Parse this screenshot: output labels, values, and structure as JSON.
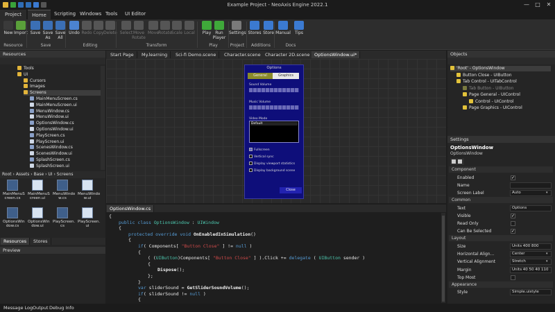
{
  "window_title": "Example Project - NeoAxis Engine 2022.1",
  "menu": {
    "project": "Project",
    "items": [
      "Home",
      "Scripting",
      "Windows",
      "Tools",
      "UI Editor"
    ]
  },
  "ribbon": {
    "buttons": [
      {
        "label": "New",
        "icon": "new-icon",
        "color": "#3a3a3a",
        "enabled": true
      },
      {
        "label": "Import",
        "icon": "import-icon",
        "color": "#5aa03a",
        "enabled": true
      },
      {
        "label": "Save",
        "icon": "save-icon",
        "color": "#3b6fb5",
        "enabled": true
      },
      {
        "label": "Save As",
        "icon": "save-as-icon",
        "color": "#3b6fb5",
        "enabled": true
      },
      {
        "label": "Save All",
        "icon": "save-all-icon",
        "color": "#3b6fb5",
        "enabled": true
      },
      {
        "label": "Undo",
        "icon": "undo-icon",
        "color": "#4b83d1",
        "enabled": true
      },
      {
        "label": "Redo",
        "icon": "redo-icon",
        "color": "#555",
        "enabled": false
      },
      {
        "label": "Copy",
        "icon": "copy-icon",
        "color": "#555",
        "enabled": false
      },
      {
        "label": "Delete",
        "icon": "delete-icon",
        "color": "#555",
        "enabled": false
      },
      {
        "label": "Select",
        "icon": "select-icon",
        "color": "#555",
        "enabled": false
      },
      {
        "label": "Move Rotate",
        "icon": "move-rotate-icon",
        "color": "#555",
        "enabled": false
      },
      {
        "label": "Move",
        "icon": "move-icon",
        "color": "#555",
        "enabled": false
      },
      {
        "label": "Rotate",
        "icon": "rotate-icon",
        "color": "#555",
        "enabled": false
      },
      {
        "label": "Scale",
        "icon": "scale-icon",
        "color": "#555",
        "enabled": false
      },
      {
        "label": "Local",
        "icon": "local-icon",
        "color": "#555",
        "enabled": false
      },
      {
        "label": "Play",
        "icon": "play-icon",
        "color": "#3fa83a",
        "enabled": true
      },
      {
        "label": "Run Player",
        "icon": "run-player-icon",
        "color": "#3fa83a",
        "enabled": true
      },
      {
        "label": "Settings",
        "icon": "settings-icon",
        "color": "#7a7a7a",
        "enabled": true
      },
      {
        "label": "Stores",
        "icon": "stores-icon",
        "color": "#3b7ad1",
        "enabled": true
      },
      {
        "label": "Store",
        "icon": "store-icon",
        "color": "#3b7ad1",
        "enabled": true
      },
      {
        "label": "Manual",
        "icon": "manual-icon",
        "color": "#3b7ad1",
        "enabled": true
      },
      {
        "label": "Tips",
        "icon": "tips-icon",
        "color": "#3b7ad1",
        "enabled": true
      }
    ],
    "groups": [
      "Resource",
      "Save",
      "Editing",
      "Transform",
      "Play",
      "Project",
      "Additions",
      "Docs"
    ]
  },
  "resources": {
    "title": "Resources",
    "tree": [
      {
        "label": "Tools",
        "indent": 1
      },
      {
        "label": "UI",
        "indent": 1
      },
      {
        "label": "Cursors",
        "indent": 2
      },
      {
        "label": "Images",
        "indent": 2
      },
      {
        "label": "Screens",
        "indent": 2
      },
      {
        "label": "MainMenuScreen.cs",
        "indent": 3
      },
      {
        "label": "MainMenuScreen.ui",
        "indent": 3
      },
      {
        "label": "MenuWindow.cs",
        "indent": 3
      },
      {
        "label": "MenuWindow.ui",
        "indent": 3
      },
      {
        "label": "OptionsWindow.cs",
        "indent": 3
      },
      {
        "label": "OptionsWindow.ui",
        "indent": 3
      },
      {
        "label": "PlayScreen.cs",
        "indent": 3
      },
      {
        "label": "PlayScreen.ui",
        "indent": 3
      },
      {
        "label": "ScenesWindow.cs",
        "indent": 3
      },
      {
        "label": "ScenesWindow.ui",
        "indent": 3
      },
      {
        "label": "SplashScreen.cs",
        "indent": 3
      },
      {
        "label": "SplashScreen.ui",
        "indent": 3
      }
    ],
    "breadcrumb": [
      "Root",
      "Assets",
      "Base",
      "UI",
      "Screens"
    ],
    "grid": [
      {
        "label": "MainMenuS creen.cs",
        "kind": "cs"
      },
      {
        "label": "MainMenuS creen.ui",
        "kind": "ui"
      },
      {
        "label": "MenuWindo w.cs",
        "kind": "cs"
      },
      {
        "label": "MenuWindo w.ui",
        "kind": "ui"
      },
      {
        "label": "OptionsWin dow.cs",
        "kind": "cs"
      },
      {
        "label": "OptionsWin dow.ui",
        "kind": "ui"
      },
      {
        "label": "PlayScreen. cs",
        "kind": "cs"
      },
      {
        "label": "PlayScreen. ui",
        "kind": "ui"
      }
    ],
    "bottom_tabs": [
      "Resources",
      "Stores"
    ],
    "preview": "Preview"
  },
  "doc_tabs": [
    "Start Page",
    "My.learning",
    "Sci-fi Demo.scene",
    "Character.scene",
    "Character 2D.scene",
    "OptionsWindow.ui*"
  ],
  "options_window": {
    "title": "Options",
    "tabs": [
      "General",
      "Graphics"
    ],
    "sound_volume": "Sound Volume",
    "music_volume": "Music Volume",
    "video_mode": "Video Mode",
    "video_mode_value": "Default",
    "checks": [
      {
        "label": "Fullscreen",
        "checked": true
      },
      {
        "label": "Vertical sync",
        "checked": false
      },
      {
        "label": "Display viewport statistics",
        "checked": false
      },
      {
        "label": "Display background scene",
        "checked": false
      }
    ],
    "close": "Close"
  },
  "code": {
    "tab": "OptionsWindow.cs",
    "lines": [
      {
        "t": [
          [
            "{",
            "p"
          ]
        ],
        "ind": 0
      },
      {
        "t": [
          [
            "public ",
            "kw"
          ],
          [
            "class ",
            "kw"
          ],
          [
            "OptionsWindow",
            "ty"
          ],
          [
            " : ",
            "p"
          ],
          [
            "UIWindow",
            "ty"
          ]
        ],
        "ind": 1
      },
      {
        "t": [
          [
            "{",
            "p"
          ]
        ],
        "ind": 1
      },
      {
        "t": [
          [
            "protected ",
            "kw"
          ],
          [
            "override ",
            "kw"
          ],
          [
            "void ",
            "kw"
          ],
          [
            "OnEnabledInSimulation",
            "fn"
          ],
          [
            "()",
            "p"
          ]
        ],
        "ind": 2
      },
      {
        "t": [
          [
            "{",
            "p"
          ]
        ],
        "ind": 2
      },
      {
        "t": [
          [
            "if",
            "kw"
          ],
          [
            "( Components[ ",
            "p"
          ],
          [
            "\"Button Close\"",
            "st"
          ],
          [
            " ] != ",
            "p"
          ],
          [
            "null",
            "kw"
          ],
          [
            " )",
            "p"
          ]
        ],
        "ind": 3
      },
      {
        "t": [
          [
            "{",
            "p"
          ]
        ],
        "ind": 3
      },
      {
        "t": [
          [
            "( (",
            "p"
          ],
          [
            "UIButton",
            "ty"
          ],
          [
            ")Components[ ",
            "p"
          ],
          [
            "\"Button Close\"",
            "st"
          ],
          [
            " ] ).Click += ",
            "p"
          ],
          [
            "delegate",
            "kw"
          ],
          [
            " ( ",
            "p"
          ],
          [
            "UIButton",
            "ty"
          ],
          [
            " sender )",
            "p"
          ]
        ],
        "ind": 4
      },
      {
        "t": [
          [
            "{",
            "p"
          ]
        ],
        "ind": 4
      },
      {
        "t": [
          [
            "Dispose",
            "fn"
          ],
          [
            "();",
            "p"
          ]
        ],
        "ind": 5
      },
      {
        "t": [
          [
            "};",
            "p"
          ]
        ],
        "ind": 4
      },
      {
        "t": [
          [
            "}",
            "p"
          ]
        ],
        "ind": 3
      },
      {
        "t": [
          [
            "var ",
            "kw"
          ],
          [
            "sliderSound = ",
            "p"
          ],
          [
            "GetSliderSoundVolume",
            "fn"
          ],
          [
            "();",
            "p"
          ]
        ],
        "ind": 3
      },
      {
        "t": [
          [
            "if",
            "kw"
          ],
          [
            "( sliderSound != ",
            "p"
          ],
          [
            "null",
            "kw"
          ],
          [
            " )",
            "p"
          ]
        ],
        "ind": 3
      },
      {
        "t": [
          [
            "{",
            "p"
          ]
        ],
        "ind": 3
      }
    ]
  },
  "objects": {
    "title": "Objects",
    "tree": [
      {
        "label": "'Root' - OptionsWindow",
        "indent": 0,
        "dim": false
      },
      {
        "label": "Button Close - UIButton",
        "indent": 1,
        "dim": false
      },
      {
        "label": "Tab Control - UITabControl",
        "indent": 1,
        "dim": false
      },
      {
        "label": "Tab Button - UIButton",
        "indent": 2,
        "dim": true
      },
      {
        "label": "Page General - UIControl",
        "indent": 2,
        "dim": false
      },
      {
        "label": "Control - UIControl",
        "indent": 3,
        "dim": false
      },
      {
        "label": "Page Graphics - UIControl",
        "indent": 2,
        "dim": false
      }
    ]
  },
  "settings": {
    "title": "Settings",
    "object_name": "OptionsWindow",
    "object_type": "OptionsWindow",
    "sections": [
      {
        "name": "Component",
        "props": [
          {
            "label": "Enabled",
            "type": "check",
            "value": "✓"
          },
          {
            "label": "Name",
            "type": "text",
            "value": ""
          },
          {
            "label": "Screen Label",
            "type": "combo",
            "value": "Auto"
          }
        ]
      },
      {
        "name": "Common",
        "props": [
          {
            "label": "Text",
            "type": "text",
            "value": "Options"
          },
          {
            "label": "Visible",
            "type": "check",
            "value": "✓"
          },
          {
            "label": "Read Only",
            "type": "check",
            "value": ""
          },
          {
            "label": "Can Be Selected",
            "type": "check",
            "value": "✓"
          }
        ]
      },
      {
        "name": "Layout",
        "props": [
          {
            "label": "Size",
            "type": "text",
            "value": "Units 400 800"
          },
          {
            "label": "Horizontal Align...",
            "type": "combo",
            "value": "Center"
          },
          {
            "label": "Vertical Alignment",
            "type": "combo",
            "value": "Stretch"
          },
          {
            "label": "Margin",
            "type": "text",
            "value": "Units 40 50 40 110"
          },
          {
            "label": "Top Most",
            "type": "check",
            "value": ""
          }
        ]
      },
      {
        "name": "Appearance",
        "props": [
          {
            "label": "Style",
            "type": "text",
            "value": "Simple.uistyle"
          }
        ]
      }
    ]
  },
  "status": [
    "Message Log",
    "Output",
    "Debug Info"
  ]
}
